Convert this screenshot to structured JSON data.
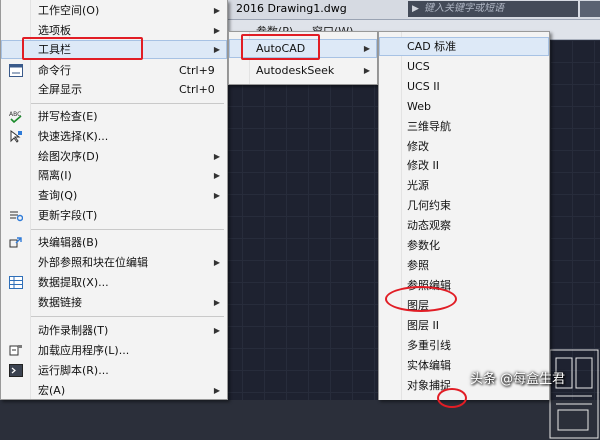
{
  "window": {
    "title": "2016   Drawing1.dwg",
    "search_placeholder": "键入关键字或短语",
    "menubar": [
      "参数(P)",
      "窗口(W)"
    ]
  },
  "menu1": {
    "items": [
      {
        "label": "工作空间(O)",
        "submenu": true
      },
      {
        "label": "选项板",
        "submenu": true
      },
      {
        "label": "工具栏",
        "submenu": true,
        "highlighted": true
      },
      {
        "label": "命令行",
        "shortcut": "Ctrl+9",
        "icon": "command-line-icon"
      },
      {
        "label": "全屏显示",
        "shortcut": "Ctrl+0"
      },
      {
        "label": "拼写检查(E)",
        "icon": "spell-check-icon"
      },
      {
        "label": "快速选择(K)...",
        "icon": "quick-select-icon"
      },
      {
        "label": "绘图次序(D)",
        "submenu": true
      },
      {
        "label": "隔离(I)",
        "submenu": true
      },
      {
        "label": "查询(Q)",
        "submenu": true
      },
      {
        "label": "更新字段(T)",
        "icon": "update-field-icon"
      },
      {
        "label": "块编辑器(B)",
        "icon": "block-editor-icon"
      },
      {
        "label": "外部参照和块在位编辑",
        "submenu": true
      },
      {
        "label": "数据提取(X)...",
        "icon": "data-extraction-icon"
      },
      {
        "label": "数据链接",
        "submenu": true
      },
      {
        "label": "动作录制器(T)",
        "submenu": true
      },
      {
        "label": "加载应用程序(L)...",
        "icon": "load-app-icon"
      },
      {
        "label": "运行脚本(R)...",
        "icon": "run-script-icon"
      },
      {
        "label": "宏(A)",
        "submenu": true
      }
    ]
  },
  "menu2": {
    "items": [
      {
        "label": "AutoCAD",
        "submenu": true,
        "highlighted": true
      },
      {
        "label": "AutodeskSeek",
        "submenu": true
      }
    ]
  },
  "menu3": {
    "items": [
      {
        "label": "CAD 标准",
        "highlighted": true
      },
      {
        "label": "UCS"
      },
      {
        "label": "UCS II"
      },
      {
        "label": "Web"
      },
      {
        "label": "三维导航"
      },
      {
        "label": "修改"
      },
      {
        "label": "修改 II"
      },
      {
        "label": "光源"
      },
      {
        "label": "几何约束"
      },
      {
        "label": "动态观察"
      },
      {
        "label": "参数化"
      },
      {
        "label": "参照"
      },
      {
        "label": "参照编辑"
      },
      {
        "label": "图层"
      },
      {
        "label": "图层 II"
      },
      {
        "label": "多重引线"
      },
      {
        "label": "实体编辑"
      },
      {
        "label": "对象捕捉"
      }
    ]
  },
  "watermark": "头条 @每盒生君",
  "colors": {
    "annotation": "#e11d25",
    "highlight": "#dde9f7"
  }
}
